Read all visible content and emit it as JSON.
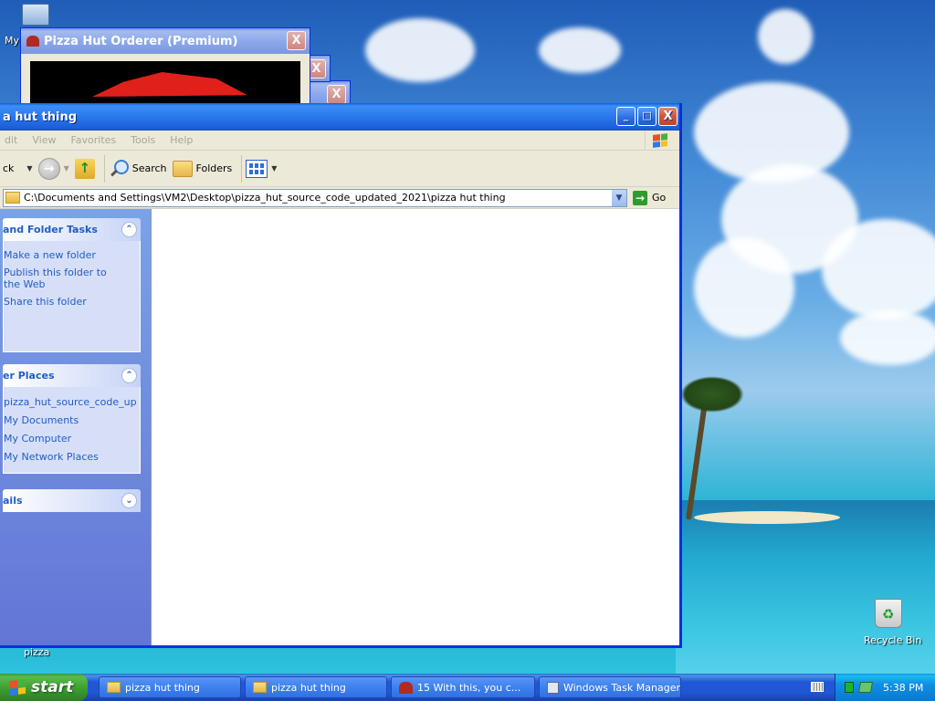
{
  "desktop": {
    "icons": [
      {
        "label": "My"
      },
      {
        "label": "Recycle Bin"
      },
      {
        "label": "pizza"
      }
    ]
  },
  "pizza_window": {
    "title": "Pizza Hut Orderer (Premium)",
    "close": "X"
  },
  "behind_windows": [
    {
      "close": "X"
    },
    {
      "close": "X"
    }
  ],
  "explorer": {
    "title": "a hut thing",
    "buttons": {
      "minimize": "_",
      "maximize": "□",
      "close": "X"
    },
    "menu": [
      "dit",
      "View",
      "Favorites",
      "Tools",
      "Help"
    ],
    "toolbar": {
      "back": "ck",
      "search": "Search",
      "folders": "Folders"
    },
    "address": "C:\\Documents and Settings\\VM2\\Desktop\\pizza_hut_source_code_updated_2021\\pizza hut thing",
    "go": "Go",
    "taskpane": {
      "file_folder_tasks": {
        "title": "and Folder Tasks",
        "links": [
          "Make a new folder",
          "Publish this folder to the Web",
          "Share this folder"
        ]
      },
      "other_places": {
        "title": "er Places",
        "links": [
          "pizza_hut_source_code_up",
          "My Documents",
          "My Computer",
          "My Network Places"
        ]
      },
      "details": {
        "title": "ails"
      }
    }
  },
  "taskbar": {
    "start": "start",
    "items": [
      {
        "label": "pizza hut thing",
        "icon": "folder-icon"
      },
      {
        "label": "pizza hut thing",
        "icon": "folder-icon"
      },
      {
        "label": "15  With this, you c...",
        "icon": "pizza-hut-icon"
      },
      {
        "label": "Windows Task Manager",
        "icon": "task-manager-icon"
      }
    ],
    "clock": "5:38 PM"
  },
  "colors": {
    "title_active": "#2a77ee",
    "taskpane": "#7ba2e7",
    "link": "#215dc6",
    "start_green": "#3b9a31"
  }
}
